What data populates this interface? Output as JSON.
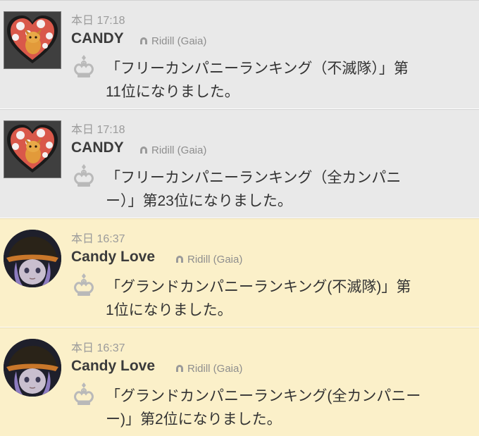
{
  "feed": {
    "items": [
      {
        "time": "本日 17:18",
        "name": "CANDY",
        "server": "Ridill (Gaia)",
        "line1": "「フリーカンパニーランキング（不滅隊）」第",
        "line2": "11位になりました。",
        "avatar": "heart-character-icon",
        "bg": "#e9e9e9"
      },
      {
        "time": "本日 17:18",
        "name": "CANDY",
        "server": "Ridill (Gaia)",
        "line1": "「フリーカンパニーランキング（全カンパニ",
        "line2": "ー）」第23位になりました。",
        "avatar": "heart-character-icon",
        "bg": "#e9e9e9"
      },
      {
        "time": "本日 16:37",
        "name": "Candy Love",
        "server": "Ridill (Gaia)",
        "line1": "「グランドカンパニーランキング(不滅隊)」第",
        "line2": "1位になりました。",
        "avatar": "witch-character-portrait",
        "bg": "#fbf0c9"
      },
      {
        "time": "本日 16:37",
        "name": "Candy Love",
        "server": "Ridill (Gaia)",
        "line1": "「グランドカンパニーランキング(全カンパニー",
        "line2": "ー)」第2位になりました。",
        "avatar": "witch-character-portrait",
        "bg": "#fbf0c9"
      }
    ]
  }
}
